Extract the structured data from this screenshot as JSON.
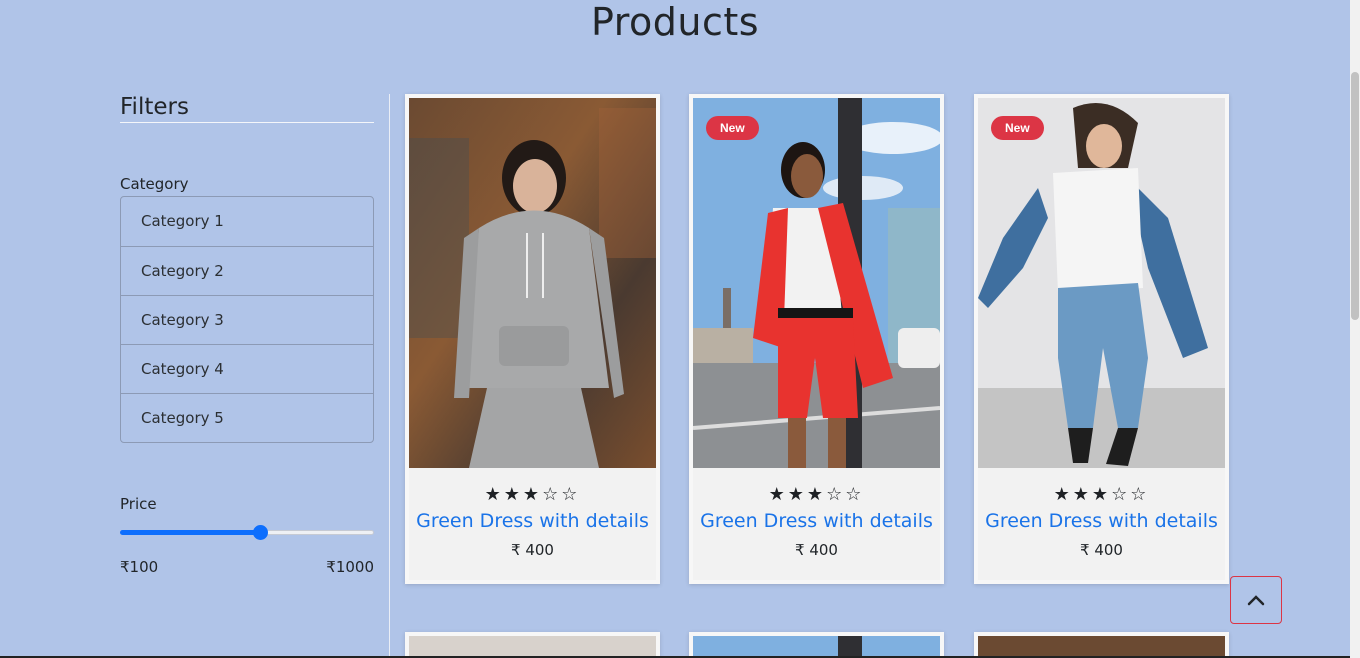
{
  "page": {
    "title": "Products"
  },
  "filters": {
    "title": "Filters",
    "category_label": "Category",
    "categories": [
      "Category 1",
      "Category 2",
      "Category 3",
      "Category 4",
      "Category 5"
    ],
    "price_label": "Price",
    "price_min": "₹100",
    "price_max": "₹1000",
    "price_slider_fraction": 0.55,
    "accent_color": "#0d6efd"
  },
  "products": [
    {
      "name": "Green Dress with details",
      "price": "₹ 400",
      "rating": 3,
      "max_rating": 5,
      "badge": ""
    },
    {
      "name": "Green Dress with details",
      "price": "₹ 400",
      "rating": 3,
      "max_rating": 5,
      "badge": "New"
    },
    {
      "name": "Green Dress with details",
      "price": "₹ 400",
      "rating": 3,
      "max_rating": 5,
      "badge": "New"
    }
  ],
  "colors": {
    "background": "#b0c4e8",
    "badge": "#dc3545",
    "link": "#1a73e8"
  },
  "icons": {
    "star_filled": "star-filled-icon",
    "star_empty": "star-empty-icon",
    "back_to_top": "chevron-up-icon"
  }
}
